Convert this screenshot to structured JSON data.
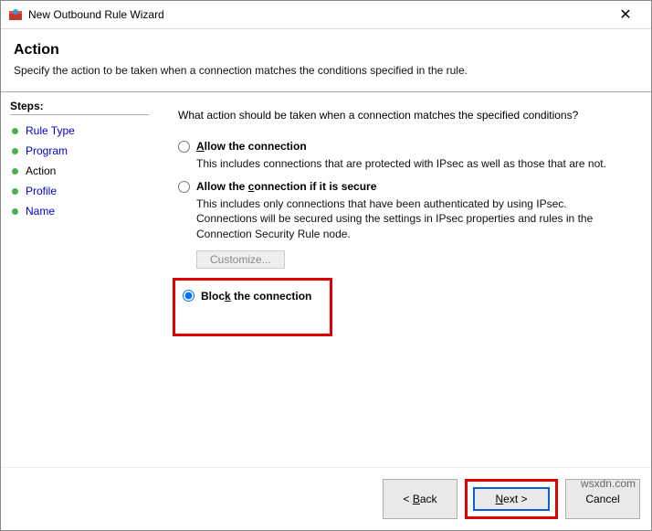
{
  "window": {
    "title": "New Outbound Rule Wizard",
    "close": "✕"
  },
  "header": {
    "heading": "Action",
    "description": "Specify the action to be taken when a connection matches the conditions specified in the rule."
  },
  "sidebar": {
    "label": "Steps:",
    "items": [
      {
        "label": "Rule Type"
      },
      {
        "label": "Program"
      },
      {
        "label": "Action"
      },
      {
        "label": "Profile"
      },
      {
        "label": "Name"
      }
    ]
  },
  "main": {
    "question": "What action should be taken when a connection matches the specified conditions?",
    "options": [
      {
        "label": "Allow the connection",
        "hint": "This includes connections that are protected with IPsec as well as those that are not."
      },
      {
        "label": "Allow the connection if it is secure",
        "hint": "This includes only connections that have been authenticated by using IPsec.  Connections will be secured using the settings in IPsec properties and rules in the Connection Security Rule node."
      },
      {
        "label": "Block the connection"
      }
    ],
    "customize": "Customize..."
  },
  "footer": {
    "back": "< Back",
    "next": "Next >",
    "cancel": "Cancel"
  },
  "watermark": "wsxdn.com"
}
